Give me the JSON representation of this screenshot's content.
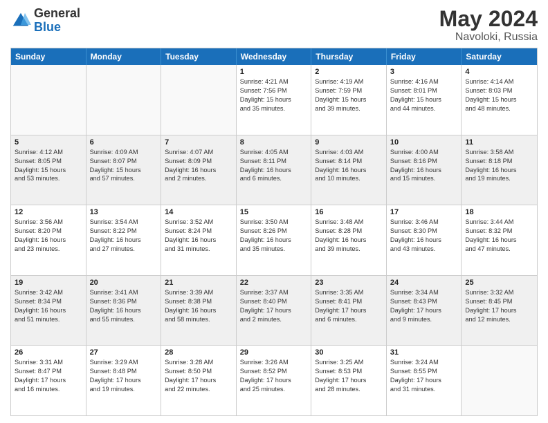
{
  "header": {
    "logo_general": "General",
    "logo_blue": "Blue",
    "title": "May 2024",
    "location": "Navoloki, Russia"
  },
  "calendar": {
    "days_of_week": [
      "Sunday",
      "Monday",
      "Tuesday",
      "Wednesday",
      "Thursday",
      "Friday",
      "Saturday"
    ],
    "rows": [
      [
        {
          "day": "",
          "text": "",
          "empty": true
        },
        {
          "day": "",
          "text": "",
          "empty": true
        },
        {
          "day": "",
          "text": "",
          "empty": true
        },
        {
          "day": "1",
          "text": "Sunrise: 4:21 AM\nSunset: 7:56 PM\nDaylight: 15 hours\nand 35 minutes."
        },
        {
          "day": "2",
          "text": "Sunrise: 4:19 AM\nSunset: 7:59 PM\nDaylight: 15 hours\nand 39 minutes."
        },
        {
          "day": "3",
          "text": "Sunrise: 4:16 AM\nSunset: 8:01 PM\nDaylight: 15 hours\nand 44 minutes."
        },
        {
          "day": "4",
          "text": "Sunrise: 4:14 AM\nSunset: 8:03 PM\nDaylight: 15 hours\nand 48 minutes."
        }
      ],
      [
        {
          "day": "5",
          "text": "Sunrise: 4:12 AM\nSunset: 8:05 PM\nDaylight: 15 hours\nand 53 minutes."
        },
        {
          "day": "6",
          "text": "Sunrise: 4:09 AM\nSunset: 8:07 PM\nDaylight: 15 hours\nand 57 minutes."
        },
        {
          "day": "7",
          "text": "Sunrise: 4:07 AM\nSunset: 8:09 PM\nDaylight: 16 hours\nand 2 minutes."
        },
        {
          "day": "8",
          "text": "Sunrise: 4:05 AM\nSunset: 8:11 PM\nDaylight: 16 hours\nand 6 minutes."
        },
        {
          "day": "9",
          "text": "Sunrise: 4:03 AM\nSunset: 8:14 PM\nDaylight: 16 hours\nand 10 minutes."
        },
        {
          "day": "10",
          "text": "Sunrise: 4:00 AM\nSunset: 8:16 PM\nDaylight: 16 hours\nand 15 minutes."
        },
        {
          "day": "11",
          "text": "Sunrise: 3:58 AM\nSunset: 8:18 PM\nDaylight: 16 hours\nand 19 minutes."
        }
      ],
      [
        {
          "day": "12",
          "text": "Sunrise: 3:56 AM\nSunset: 8:20 PM\nDaylight: 16 hours\nand 23 minutes."
        },
        {
          "day": "13",
          "text": "Sunrise: 3:54 AM\nSunset: 8:22 PM\nDaylight: 16 hours\nand 27 minutes."
        },
        {
          "day": "14",
          "text": "Sunrise: 3:52 AM\nSunset: 8:24 PM\nDaylight: 16 hours\nand 31 minutes."
        },
        {
          "day": "15",
          "text": "Sunrise: 3:50 AM\nSunset: 8:26 PM\nDaylight: 16 hours\nand 35 minutes."
        },
        {
          "day": "16",
          "text": "Sunrise: 3:48 AM\nSunset: 8:28 PM\nDaylight: 16 hours\nand 39 minutes."
        },
        {
          "day": "17",
          "text": "Sunrise: 3:46 AM\nSunset: 8:30 PM\nDaylight: 16 hours\nand 43 minutes."
        },
        {
          "day": "18",
          "text": "Sunrise: 3:44 AM\nSunset: 8:32 PM\nDaylight: 16 hours\nand 47 minutes."
        }
      ],
      [
        {
          "day": "19",
          "text": "Sunrise: 3:42 AM\nSunset: 8:34 PM\nDaylight: 16 hours\nand 51 minutes."
        },
        {
          "day": "20",
          "text": "Sunrise: 3:41 AM\nSunset: 8:36 PM\nDaylight: 16 hours\nand 55 minutes."
        },
        {
          "day": "21",
          "text": "Sunrise: 3:39 AM\nSunset: 8:38 PM\nDaylight: 16 hours\nand 58 minutes."
        },
        {
          "day": "22",
          "text": "Sunrise: 3:37 AM\nSunset: 8:40 PM\nDaylight: 17 hours\nand 2 minutes."
        },
        {
          "day": "23",
          "text": "Sunrise: 3:35 AM\nSunset: 8:41 PM\nDaylight: 17 hours\nand 6 minutes."
        },
        {
          "day": "24",
          "text": "Sunrise: 3:34 AM\nSunset: 8:43 PM\nDaylight: 17 hours\nand 9 minutes."
        },
        {
          "day": "25",
          "text": "Sunrise: 3:32 AM\nSunset: 8:45 PM\nDaylight: 17 hours\nand 12 minutes."
        }
      ],
      [
        {
          "day": "26",
          "text": "Sunrise: 3:31 AM\nSunset: 8:47 PM\nDaylight: 17 hours\nand 16 minutes."
        },
        {
          "day": "27",
          "text": "Sunrise: 3:29 AM\nSunset: 8:48 PM\nDaylight: 17 hours\nand 19 minutes."
        },
        {
          "day": "28",
          "text": "Sunrise: 3:28 AM\nSunset: 8:50 PM\nDaylight: 17 hours\nand 22 minutes."
        },
        {
          "day": "29",
          "text": "Sunrise: 3:26 AM\nSunset: 8:52 PM\nDaylight: 17 hours\nand 25 minutes."
        },
        {
          "day": "30",
          "text": "Sunrise: 3:25 AM\nSunset: 8:53 PM\nDaylight: 17 hours\nand 28 minutes."
        },
        {
          "day": "31",
          "text": "Sunrise: 3:24 AM\nSunset: 8:55 PM\nDaylight: 17 hours\nand 31 minutes."
        },
        {
          "day": "",
          "text": "",
          "empty": true
        }
      ]
    ]
  }
}
